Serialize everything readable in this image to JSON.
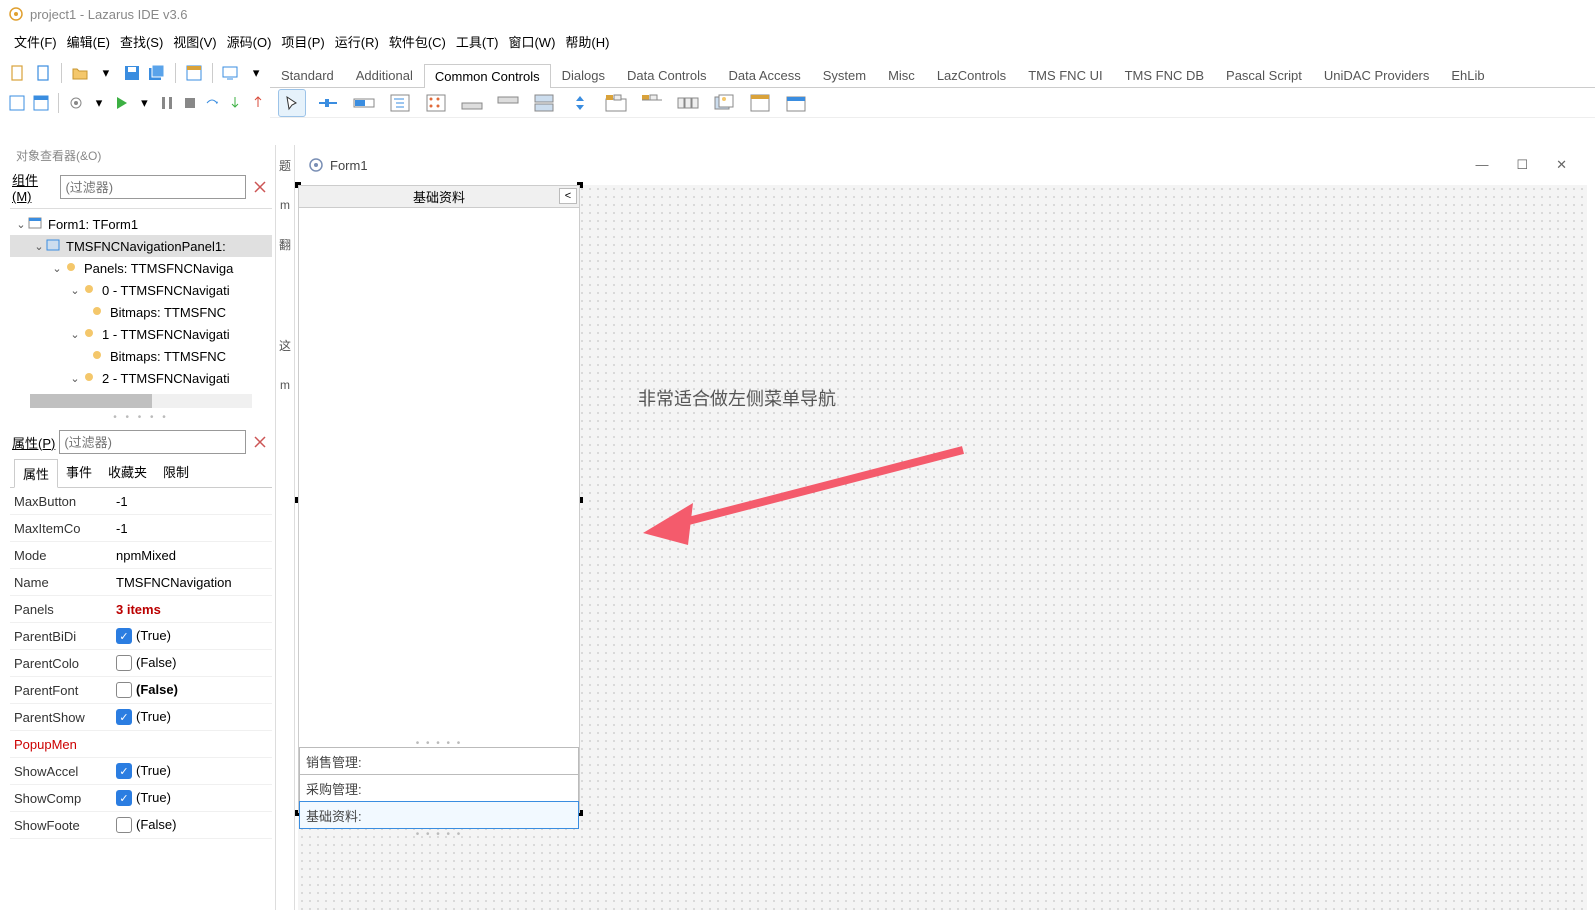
{
  "title": "project1 - Lazarus IDE v3.6",
  "menu": [
    "文件(F)",
    "编辑(E)",
    "查找(S)",
    "视图(V)",
    "源码(O)",
    "项目(P)",
    "运行(R)",
    "软件包(C)",
    "工具(T)",
    "窗口(W)",
    "帮助(H)"
  ],
  "tabs": [
    "Standard",
    "Additional",
    "Common Controls",
    "Dialogs",
    "Data Controls",
    "Data Access",
    "System",
    "Misc",
    "LazControls",
    "TMS FNC UI",
    "TMS FNC DB",
    "Pascal Script",
    "UniDAC Providers",
    "EhLib"
  ],
  "active_tab": "Common Controls",
  "obj_inspector_title": "对象查看器(&O)",
  "component_label": "组件(M)",
  "filter_placeholder": "(过滤器)",
  "tree": {
    "root": "Form1: TForm1",
    "n0": "TMSFNCNavigationPanel1:",
    "n1": "Panels: TTMSFNCNaviga",
    "n2": "0 - TTMSFNCNavigati",
    "n2b": "Bitmaps: TTMSFNC",
    "n3": "1 - TTMSFNCNavigati",
    "n3b": "Bitmaps: TTMSFNC",
    "n4": "2 - TTMSFNCNavigati",
    "n4b": "Bitmaps: TTMSFNC"
  },
  "properties_label": "属性(P)",
  "prop_tabs": [
    "属性",
    "事件",
    "收藏夹",
    "限制"
  ],
  "props": [
    {
      "name": "MaxButton",
      "val": "-1"
    },
    {
      "name": "MaxItemCo",
      "val": "-1"
    },
    {
      "name": "Mode",
      "val": "npmMixed"
    },
    {
      "name": "Name",
      "val": "TMSFNCNavigation"
    },
    {
      "name": "Panels",
      "val": "3 items",
      "bold": true
    },
    {
      "name": "ParentBiDi",
      "val": "(True)",
      "chk": true
    },
    {
      "name": "ParentColo",
      "val": "(False)",
      "chk": false
    },
    {
      "name": "ParentFont",
      "val": "(False)",
      "chk": false,
      "boldblack": true
    },
    {
      "name": "ParentShow",
      "val": "(True)",
      "chk": true
    },
    {
      "name": "PopupMen",
      "val": "",
      "red": true
    },
    {
      "name": "ShowAccel",
      "val": "(True)",
      "chk": true
    },
    {
      "name": "ShowComp",
      "val": "(True)",
      "chk": true
    },
    {
      "name": "ShowFoote",
      "val": "(False)",
      "chk": false
    }
  ],
  "form_title": "Form1",
  "navpanel_header": "基础资料",
  "nav_items": [
    "销售管理:",
    "采购管理:",
    "基础资料:"
  ],
  "annotation_text": "非常适合做左侧菜单导航",
  "gutter_markers": [
    "题",
    "m",
    "翻",
    "这",
    "m"
  ]
}
